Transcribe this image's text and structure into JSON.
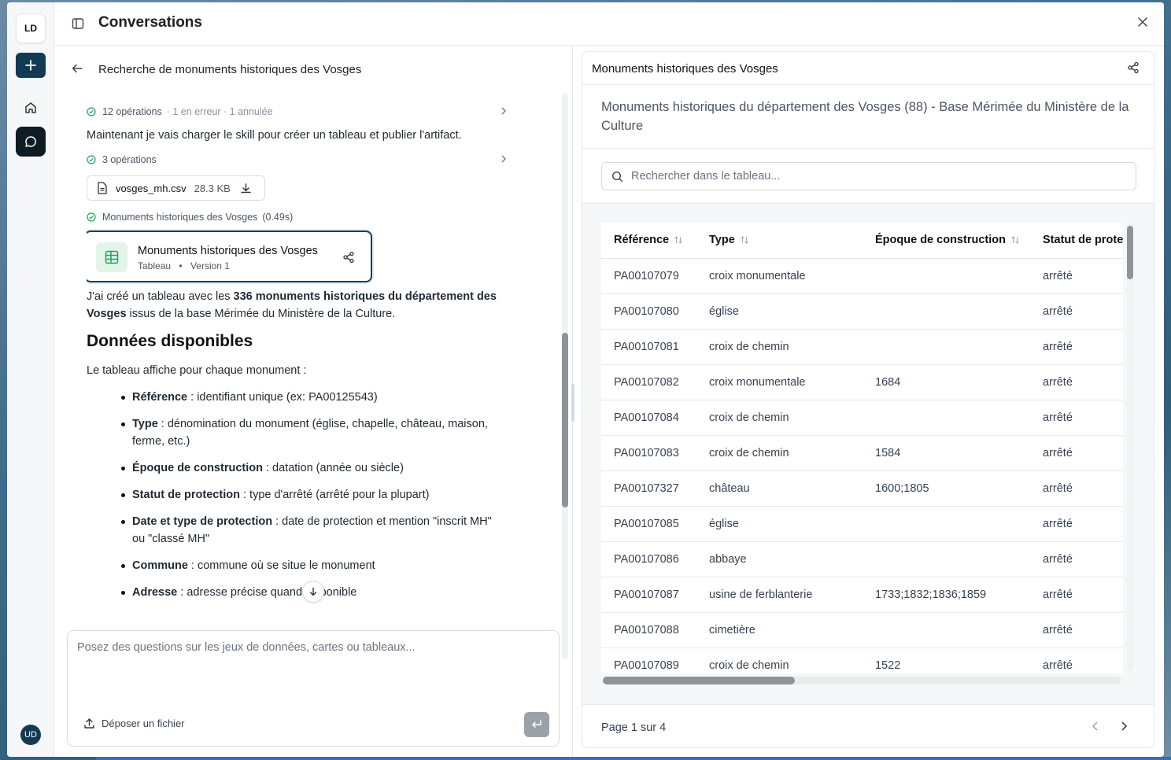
{
  "rail": {
    "logo": "LD",
    "user": "UD"
  },
  "header": {
    "title": "Conversations"
  },
  "conversation": {
    "title": "Recherche de monuments historiques des Vosges",
    "ops1": {
      "label": "12 opérations",
      "extra": "· 1 en erreur · 1 annulée"
    },
    "msg1": "Maintenant je vais charger le skill pour créer un tableau et publier l'artifact.",
    "ops2": {
      "label": "3 opérations"
    },
    "file": {
      "name": "vosges_mh.csv",
      "size": "28.3 KB"
    },
    "ops3": {
      "label": "Monuments historiques des Vosges",
      "time": "(0.49s)"
    },
    "artifact": {
      "name": "Monuments historiques des Vosges",
      "kind": "Tableau",
      "sep": "•",
      "version": "Version 1"
    },
    "summary": {
      "pre": "J'ai créé un tableau avec les ",
      "bold": "336 monuments historiques du département des Vosges",
      "post": " issus de la base Mérimée du Ministère de la Culture."
    },
    "section_title": "Données disponibles",
    "section_intro": "Le tableau affiche pour chaque monument :",
    "bullets": [
      {
        "term": "Référence",
        "desc": " : identifiant unique (ex: PA00125543)"
      },
      {
        "term": "Type",
        "desc": " : dénomination du monument (église, chapelle, château, maison, ferme, etc.)"
      },
      {
        "term": "Époque de construction",
        "desc": " : datation (année ou siècle)"
      },
      {
        "term": "Statut de protection",
        "desc": " : type d'arrêté (arrêté pour la plupart)"
      },
      {
        "term": "Date et type de protection",
        "desc": " : date de protection et mention \"inscrit MH\" ou \"classé MH\""
      },
      {
        "term": "Commune",
        "desc": " : commune où se situe le monument"
      },
      {
        "term": "Adresse",
        "desc": " : adresse précise quand disponible"
      }
    ],
    "input_placeholder": "Posez des questions sur les jeux de données, cartes ou tableaux...",
    "upload_label": "Déposer un fichier"
  },
  "panel": {
    "title": "Monuments historiques des Vosges",
    "description": "Monuments historiques du département des Vosges (88) - Base Mérimée du Ministère de la Culture",
    "search_placeholder": "Rechercher dans le tableau...",
    "columns": [
      "Référence",
      "Type",
      "Époque de construction",
      "Statut de protection"
    ],
    "rows": [
      [
        "PA00107079",
        "croix monumentale",
        "",
        "arrêté"
      ],
      [
        "PA00107080",
        "église",
        "",
        "arrêté"
      ],
      [
        "PA00107081",
        "croix de chemin",
        "",
        "arrêté"
      ],
      [
        "PA00107082",
        "croix monumentale",
        "1684",
        "arrêté"
      ],
      [
        "PA00107084",
        "croix de chemin",
        "",
        "arrêté"
      ],
      [
        "PA00107083",
        "croix de chemin",
        "1584",
        "arrêté"
      ],
      [
        "PA00107327",
        "château",
        "1600;1805",
        "arrêté"
      ],
      [
        "PA00107085",
        "église",
        "",
        "arrêté"
      ],
      [
        "PA00107086",
        "abbaye",
        "",
        "arrêté"
      ],
      [
        "PA00107087",
        "usine de ferblanterie",
        "1733;1832;1836;1859",
        "arrêté"
      ],
      [
        "PA00107088",
        "cimetière",
        "",
        "arrêté"
      ],
      [
        "PA00107089",
        "croix de chemin",
        "1522",
        "arrêté"
      ]
    ],
    "pager": "Page 1 sur 4"
  },
  "colors": {
    "brand": "#123a52",
    "accent": "#1c3f57",
    "success": "#22a35a"
  }
}
